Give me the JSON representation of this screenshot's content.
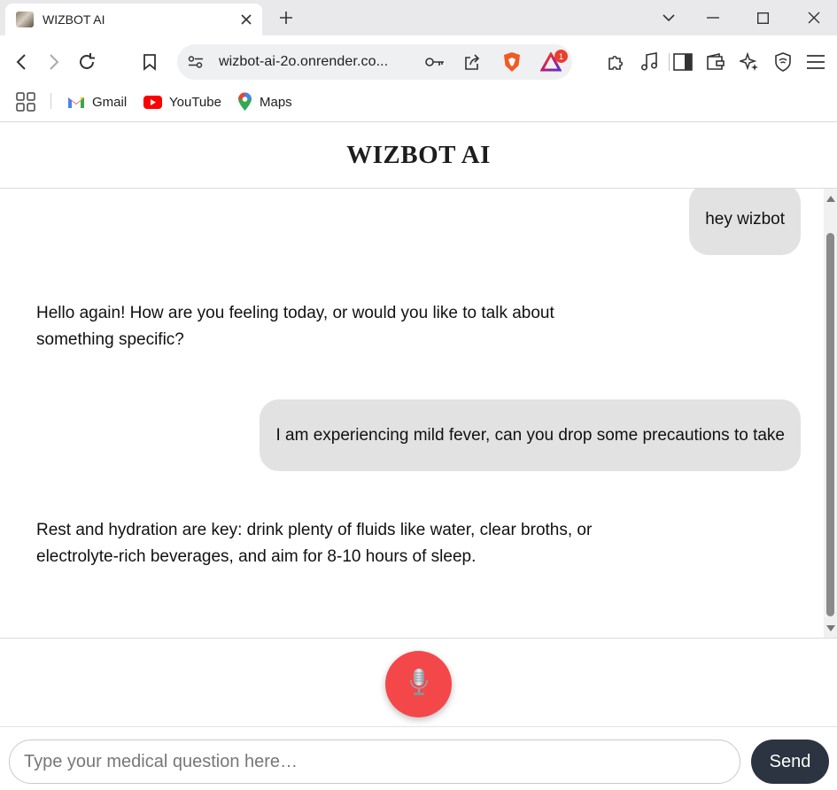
{
  "browser": {
    "tab_title": "WIZBOT AI",
    "url": "wizbot-ai-2o.onrender.co...",
    "notification_count": "1",
    "bookmarks": [
      {
        "label": "Gmail"
      },
      {
        "label": "YouTube"
      },
      {
        "label": "Maps"
      }
    ]
  },
  "page": {
    "title": "WIZBOT AI"
  },
  "chat": {
    "messages": [
      {
        "role": "user",
        "text": "hey wizbot"
      },
      {
        "role": "bot",
        "text": "Hello again! How are you feeling today, or would you like to talk about something specific?"
      },
      {
        "role": "user",
        "text": "I am experiencing mild fever, can you drop some precautions to take"
      },
      {
        "role": "bot",
        "text": "Rest and hydration are key: drink plenty of fluids like water, clear broths, or electrolyte-rich beverages, and aim for 8-10 hours of sleep."
      }
    ]
  },
  "composer": {
    "placeholder": "Type your medical question here…",
    "value": "",
    "send_label": "Send"
  },
  "colors": {
    "mic_button": "#f4474a",
    "send_button": "#2b3440",
    "user_bubble": "#e2e2e2"
  }
}
